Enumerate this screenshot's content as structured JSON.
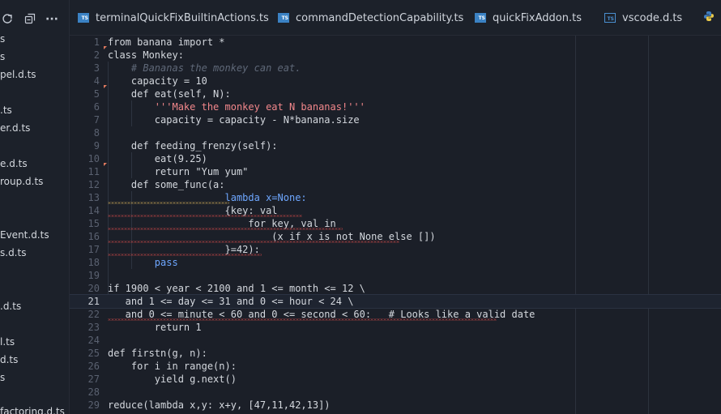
{
  "sidebar": {
    "toolbar_icons": [
      "refresh-icon",
      "collapse-all-icon",
      "more-icon"
    ],
    "more_glyph": "···",
    "items": [
      "s",
      "s",
      "pel.d.ts",
      ".ts",
      "er.d.ts",
      "e.d.ts",
      "roup.d.ts",
      "Event.d.ts",
      "s.d.ts",
      ".d.ts",
      "l.ts",
      "d.ts",
      "s",
      "factoring.d.ts"
    ]
  },
  "tabs": [
    {
      "label": "terminalQuickFixBuiltinActions.ts",
      "icon": "ts-icon"
    },
    {
      "label": "commandDetectionCapability.ts",
      "icon": "ts-icon"
    },
    {
      "label": "quickFixAddon.ts",
      "icon": "ts-icon"
    },
    {
      "label": "vscode.d.ts",
      "icon": "ts-declaration-icon"
    },
    {
      "label": "",
      "icon": "python-icon"
    }
  ],
  "ts_icon_text": "TS",
  "editor": {
    "current_line": 21,
    "lines": [
      {
        "n": "1",
        "text": "from banana import *"
      },
      {
        "n": "2",
        "text": "class Monkey:"
      },
      {
        "n": "3",
        "text": "    # Bananas the monkey can eat."
      },
      {
        "n": "4",
        "text": "    capacity = 10"
      },
      {
        "n": "5",
        "text": "    def eat(self, N):"
      },
      {
        "n": "6",
        "text": "        '''Make the monkey eat N bananas!'''"
      },
      {
        "n": "7",
        "text": "        capacity = capacity - N*banana.size"
      },
      {
        "n": "8",
        "text": ""
      },
      {
        "n": "9",
        "text": "    def feeding_frenzy(self):"
      },
      {
        "n": "10",
        "text": "        eat(9.25)"
      },
      {
        "n": "11",
        "text": "        return \"Yum yum\""
      },
      {
        "n": "12",
        "text": "    def some_func(a:"
      },
      {
        "n": "13",
        "text": "                    lambda x=None:"
      },
      {
        "n": "14",
        "text": "                    {key: val"
      },
      {
        "n": "15",
        "text": "                        for key, val in"
      },
      {
        "n": "16",
        "text": "                            (x if x is not None else [])"
      },
      {
        "n": "17",
        "text": "                    }=42):"
      },
      {
        "n": "18",
        "text": "        pass"
      },
      {
        "n": "19",
        "text": ""
      },
      {
        "n": "20",
        "text": "if 1900 < year < 2100 and 1 <= month <= 12 \\"
      },
      {
        "n": "21",
        "text": "   and 1 <= day <= 31 and 0 <= hour < 24 \\"
      },
      {
        "n": "22",
        "text": "   and 0 <= minute < 60 and 0 <= second < 60:   # Looks like a valid date"
      },
      {
        "n": "23",
        "text": "        return 1"
      },
      {
        "n": "24",
        "text": ""
      },
      {
        "n": "25",
        "text": "def firstn(g, n):"
      },
      {
        "n": "26",
        "text": "    for i in range(n):"
      },
      {
        "n": "27",
        "text": "        yield g.next()"
      },
      {
        "n": "28",
        "text": ""
      },
      {
        "n": "29",
        "text": "reduce(lambda x,y: x+y, [47,11,42,13])"
      }
    ]
  },
  "colors": {
    "background": "#1b1f28",
    "keyword": "#6ea7ff",
    "string": "#f2878b",
    "number": "#f08c7d",
    "comment": "#5f6878",
    "error_squiggle": "#e05252",
    "warning_squiggle": "#d8b25a"
  }
}
